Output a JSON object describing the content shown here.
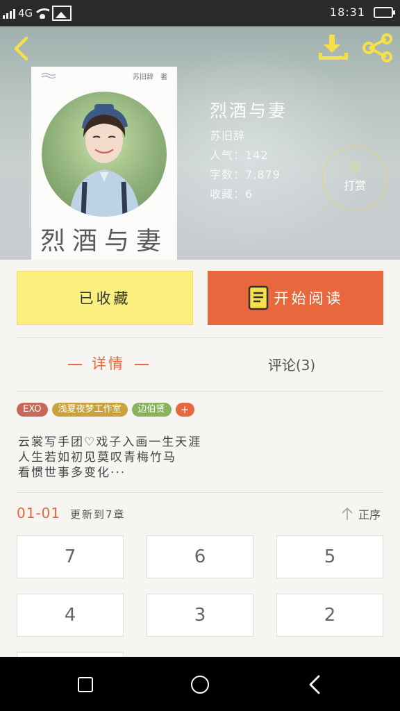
{
  "status_bar": {
    "network": "4G",
    "time": "18:31"
  },
  "book": {
    "title": "烈酒与妻",
    "author": "苏旧辞",
    "popularity": "人气：142",
    "word_count": "字数：7,879",
    "favorites": "收藏：6",
    "cover_title": "烈酒与妻",
    "cover_author": "苏旧辞　著"
  },
  "tip": {
    "count": "0",
    "label": "打赏"
  },
  "actions": {
    "favorite_label": "已收藏",
    "read_label": "开始阅读"
  },
  "tabs": {
    "detail": "详情",
    "comments": "评论(3)"
  },
  "tags": [
    {
      "label": "EXO",
      "color": "#c7695a"
    },
    {
      "label": "浅夏夜梦工作室",
      "color": "#c9a23e"
    },
    {
      "label": "边伯贤",
      "color": "#86b35c"
    },
    {
      "label": "+",
      "color": "#e8673c"
    }
  ],
  "description": [
    "云裳写手团♡戏子入画一生天涯",
    "人生若如初见莫叹青梅竹马",
    "看惯世事多变化···"
  ],
  "chapters_header": {
    "date": "01-01",
    "update_text": "更新到7章",
    "sort_label": "正序"
  },
  "chapters": [
    "7",
    "6",
    "5",
    "4",
    "3",
    "2"
  ],
  "colors": {
    "accent": "#e8673c",
    "favorite_bg": "#fbef7f",
    "gold": "#e6d27a"
  }
}
